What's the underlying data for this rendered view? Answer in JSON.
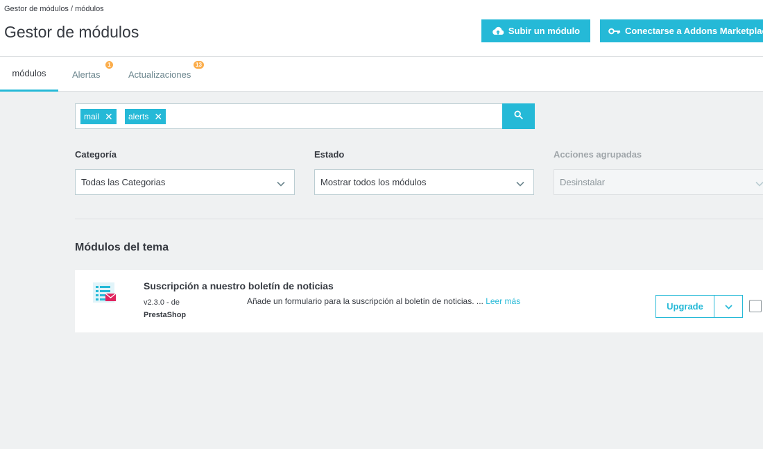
{
  "header": {
    "breadcrumb": "Gestor de módulos  /  módulos",
    "title": "Gestor de módulos",
    "upload_button": "Subir un módulo",
    "addons_button": "Conectarse a Addons Marketplace"
  },
  "tabs": [
    {
      "label": "módulos",
      "active": true
    },
    {
      "label": "Alertas",
      "badge": "1"
    },
    {
      "label": "Actualizaciones",
      "badge": "13"
    }
  ],
  "search": {
    "tags": [
      "mail",
      "alerts"
    ]
  },
  "filters": {
    "category": {
      "label": "Categoría",
      "value": "Todas las Categorias"
    },
    "status": {
      "label": "Estado",
      "value": "Mostrar todos los módulos"
    },
    "bulk": {
      "label": "Acciones agrupadas",
      "value": "Desinstalar"
    }
  },
  "section_title": "Módulos del tema",
  "module": {
    "name": "Suscripción a nuestro boletín de noticias",
    "version": "v2.3.0 - de",
    "author": "PrestaShop",
    "description": "Añade un formulario para la suscripción al boletín de noticias. ...",
    "read_more": "Leer más",
    "action": "Upgrade"
  },
  "colors": {
    "accent": "#25b9d7",
    "badge": "#fbad4b",
    "background": "#eff1f2"
  }
}
